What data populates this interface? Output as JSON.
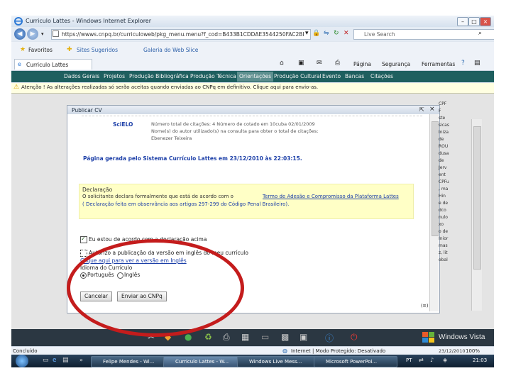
{
  "window": {
    "title": "Curriculo Lattes - Windows Internet Explorer"
  },
  "address_bar": {
    "url": "https://wwws.cnpq.br/curriculoweb/pkg_menu.menu?f_cod=B433B1CDDAE3544250FAC2BI",
    "search_placeholder": "Live Search"
  },
  "favorites_bar": {
    "favorites_label": "Favoritos",
    "items": [
      "Sites Sugeridos",
      "Galeria do Web Slice"
    ]
  },
  "tab": {
    "label": "Curriculo Lattes"
  },
  "command_bar": {
    "page_label": "Página",
    "security_label": "Segurança",
    "tools_label": "Ferramentas"
  },
  "lattes_nav": {
    "items": [
      "Dados Gerais",
      "Projetos",
      "Produção Bibliográfica",
      "Produção Técnica",
      "Orientações",
      "Produção Cultural",
      "Evento",
      "Bancas",
      "Citações"
    ],
    "active_index": 4
  },
  "info_bar": {
    "text": "Atenção ! As alterações realizadas só serão aceitas quando enviadas ao CNPq em definitivo. Clique aqui para envio-as."
  },
  "dialog": {
    "title": "Publicar CV",
    "scielo": {
      "label": "SciELO",
      "lines": [
        "Número total de citações: 4  Número de cotado em 10cuba 02/01/2009",
        "Nome(s) do autor utilizado(s) na consulta para obter o total de citações:",
        "Ebenezer Teixeira"
      ]
    },
    "generated": "Página gerada pelo Sistema Currículo Lattes em 23/12/2010 às 22:03:15.",
    "declaration": {
      "heading": "Declaração",
      "prefix": "O solicitante declara formalmente que está de acordo com o",
      "terms_link": "Termo de Adesão e Compromisso da Plataforma Lattes",
      "note": "( Declaração feita em observância aos artigos 297-299 do Código Penal Brasileiro)."
    },
    "agree_label": "Eu estou de acordo com a declaração acima",
    "authorize_label": "Autorizo a publicação da versão em inglês do meu currículo",
    "english_link": "Clique aqui para ver a versão em Inglês",
    "language_label": "Idioma do Currículo",
    "lang_pt": "Português",
    "lang_en": "Inglês",
    "cancel_label": "Cancelar",
    "send_label": "Enviar ao CNPq"
  },
  "right_column": [
    "CPF",
    "F",
    "ste",
    "sicas",
    "Iniza",
    "de",
    "ROU",
    "dusa",
    "de",
    "Jerv",
    "ent",
    "CPFu",
    ", ma",
    "Hin",
    "e de",
    "dco",
    "nulo",
    "xo",
    "o de",
    "Inior",
    "mas",
    "z, lit",
    "obal"
  ],
  "status_bar": {
    "left": "Concluído",
    "zone": "Internet | Modo Protegido: Desativado",
    "zoom": "100%"
  },
  "watermark": {
    "brand": "Windows Vista",
    "date": "23/12/2010"
  },
  "taskbar": {
    "tasks": [
      "Felipe Mendes - Wi...",
      "Curriculo Lattes - W...",
      "Windows Live Mess...",
      "Microsoft PowerPoi..."
    ],
    "lang": "PT",
    "time": "21:03"
  },
  "colors": {
    "annotation": "#c41c1c",
    "lattes_nav": "#1e5f5f",
    "link": "#1c3fa8"
  }
}
